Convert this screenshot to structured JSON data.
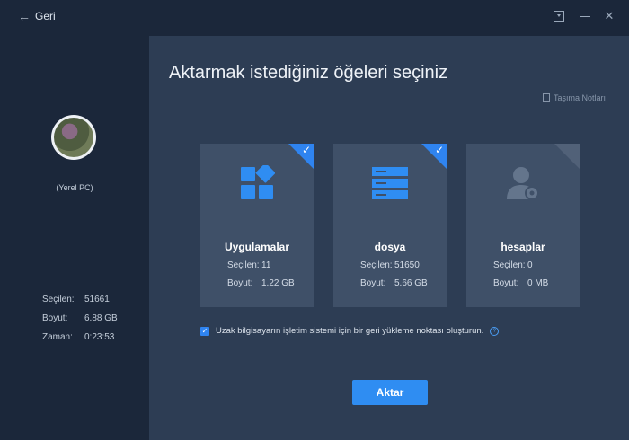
{
  "titlebar": {
    "back_label": "Geri",
    "icons": [
      "back-arrow-icon",
      "restore-icon",
      "minimize-icon",
      "close-icon"
    ]
  },
  "left": {
    "pc_name": "· ·  · · ·",
    "pc_label": "(Yerel PC)",
    "stats": [
      {
        "key": "Seçilen:",
        "value": "51661"
      },
      {
        "key": "Boyut:",
        "value": "6.88 GB"
      },
      {
        "key": "Zaman:",
        "value": "0:23:53"
      }
    ]
  },
  "main": {
    "heading": "Aktarmak istediğiniz öğeleri seçiniz",
    "notes_label": "Taşıma Notları",
    "cards": [
      {
        "title": "Uygulamalar",
        "selected_key": "Seçilen:",
        "selected_value": "11",
        "size_key": "Boyut:",
        "size_value": "1.22 GB",
        "checked": true,
        "icon": "apps-grid-icon"
      },
      {
        "title": "dosya",
        "selected_key": "Seçilen:",
        "selected_value": "51650",
        "size_key": "Boyut:",
        "size_value": "5.66 GB",
        "checked": true,
        "icon": "file-stack-icon"
      },
      {
        "title": "hesaplar",
        "selected_key": "Seçilen:",
        "selected_value": "0",
        "size_key": "Boyut:",
        "size_value": "0 MB",
        "checked": false,
        "icon": "user-account-icon"
      }
    ],
    "restore_checkbox": {
      "label": "Uzak bilgisayarın işletim sistemi için bir geri yükleme noktası oluşturun.",
      "checked": true
    },
    "action_button": "Aktar"
  },
  "colors": {
    "accent": "#2f84f0",
    "sidebar_bg": "#1b273a",
    "main_bg": "#2d3d54",
    "card_bg": "#3f5068"
  }
}
